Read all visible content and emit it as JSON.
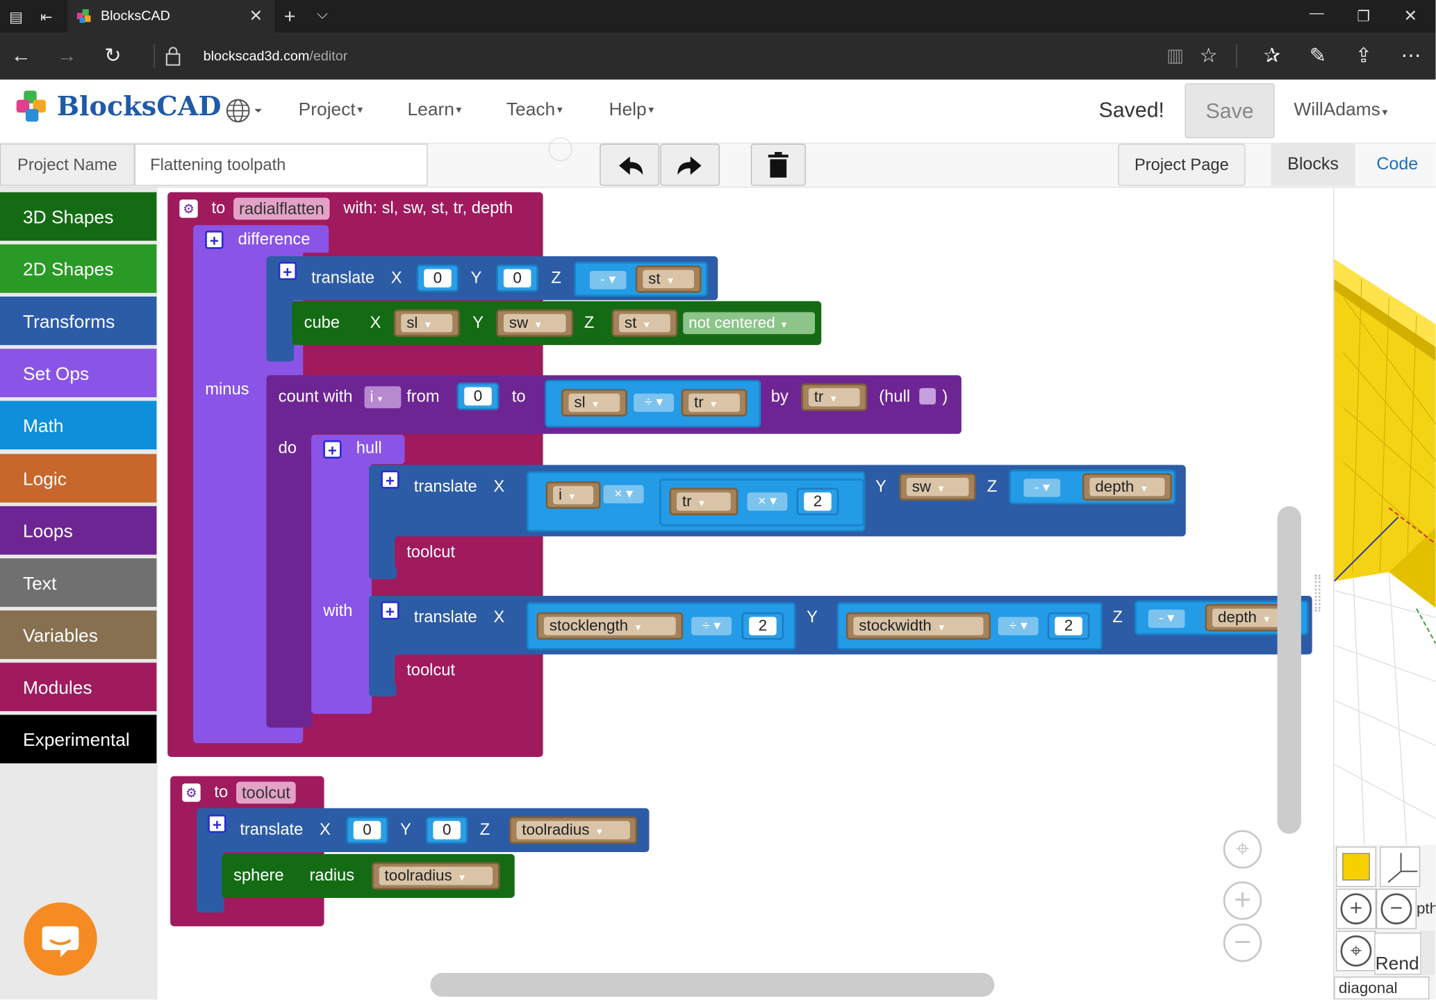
{
  "browser": {
    "tab_title": "BlocksCAD",
    "url_host": "blockscad3d.com",
    "url_path": "/editor"
  },
  "header": {
    "logo_text": "BlocksCAD",
    "menus": [
      "Project",
      "Learn",
      "Teach",
      "Help"
    ],
    "saved_status": "Saved!",
    "save_label": "Save",
    "user": "WillAdams"
  },
  "toolbar": {
    "project_name_label": "Project Name",
    "project_name_value": "Flattening toolpath",
    "project_page": "Project Page",
    "tab_blocks": "Blocks",
    "tab_code": "Code"
  },
  "categories": [
    {
      "label": "3D Shapes",
      "color": "#146b14"
    },
    {
      "label": "2D Shapes",
      "color": "#2a9a26"
    },
    {
      "label": "Transforms",
      "color": "#2d5ca6"
    },
    {
      "label": "Set Ops",
      "color": "#8a55e6"
    },
    {
      "label": "Math",
      "color": "#0f8fd9"
    },
    {
      "label": "Logic",
      "color": "#c8672c"
    },
    {
      "label": "Loops",
      "color": "#6e2594"
    },
    {
      "label": "Text",
      "color": "#707070"
    },
    {
      "label": "Variables",
      "color": "#87704f"
    },
    {
      "label": "Modules",
      "color": "#a01a5e"
    },
    {
      "label": "Experimental",
      "color": "#000000"
    }
  ],
  "blocks": {
    "to": "to",
    "radialflatten": "radialflatten",
    "with_params": "with: sl, sw, st, tr, depth",
    "difference": "difference",
    "translate": "translate",
    "X": "X",
    "Y": "Y",
    "Z": "Z",
    "zero": "0",
    "two": "2",
    "minus_op": "-",
    "st": "st",
    "sl": "sl",
    "sw": "sw",
    "tr": "tr",
    "i": "i",
    "cube": "cube",
    "not_centered": "not centered",
    "minus": "minus",
    "count_with": "count with",
    "from": "from",
    "to_kw": "to",
    "divide_op": "÷",
    "by": "by",
    "hull_paren": "(hull",
    "close_paren": ")",
    "do": "do",
    "hull": "hull",
    "times_op": "×",
    "depth": "depth",
    "toolcut": "toolcut",
    "with": "with",
    "stocklength": "stocklength",
    "stockwidth": "stockwidth",
    "toolradius": "toolradius",
    "sphere": "sphere",
    "radius": "radius"
  },
  "viewer": {
    "partial_label_1": "pth",
    "partial_label_2": "Rend",
    "view_option": "diagonal",
    "swatch_color": "#f7d000"
  },
  "colors": {
    "modules": "#a01a5e",
    "setops": "#8a55e6",
    "transforms": "#2d5ca6",
    "shapes3d": "#146b14",
    "loops": "#6e2594",
    "variables": "#a4825a",
    "math": "#239be6"
  }
}
